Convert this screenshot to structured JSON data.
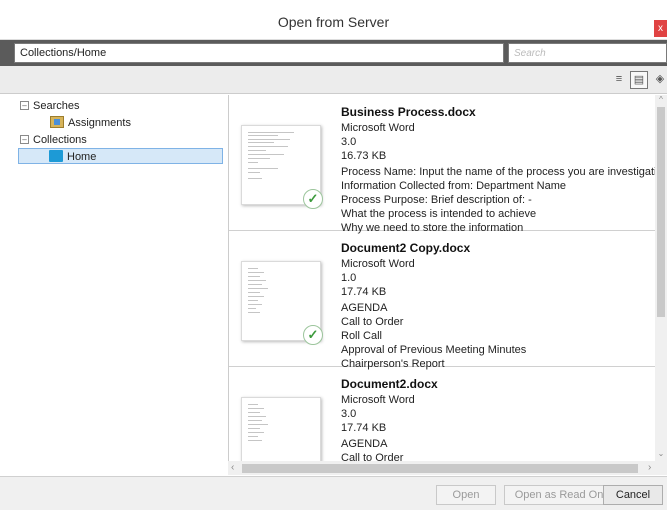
{
  "window": {
    "title": "Open from Server",
    "close_label": "x"
  },
  "pathbar": {
    "path": "Collections/Home",
    "search_placeholder": "Search"
  },
  "tree": {
    "searches_label": "Searches",
    "assignments_label": "Assignments",
    "collections_label": "Collections",
    "home_label": "Home"
  },
  "results": [
    {
      "name": "Business Process.docx",
      "app": "Microsoft Word",
      "version": "3.0",
      "size": "16.73 KB",
      "lines": [
        "Process Name: Input the name of the process you are investigating",
        "Information Collected from:  Department Name",
        "Process Purpose: Brief description of: -",
        "What the process is intended to achieve",
        "Why we need to store the information"
      ],
      "checked": true
    },
    {
      "name": "Document2 Copy.docx",
      "app": "Microsoft Word",
      "version": "1.0",
      "size": "17.74 KB",
      "lines": [
        "AGENDA",
        "Call to Order",
        "Roll Call",
        "Approval of Previous Meeting Minutes",
        "Chairperson's Report"
      ],
      "checked": true
    },
    {
      "name": "Document2.docx",
      "app": "Microsoft Word",
      "version": "3.0",
      "size": "17.74 KB",
      "lines": [
        "AGENDA",
        "Call to Order"
      ],
      "checked": false
    }
  ],
  "footer": {
    "open_label": "Open",
    "open_readonly_label": "Open as Read Only",
    "cancel_label": "Cancel"
  },
  "colors": {
    "accent": "#1d9ad6",
    "close": "#e04343",
    "selection": "#d6e8f8"
  },
  "icons": {
    "list_view": "list-view-icon",
    "detail_view": "detail-view-icon",
    "tag": "tag-icon",
    "checkmark": "checkmark-icon"
  }
}
